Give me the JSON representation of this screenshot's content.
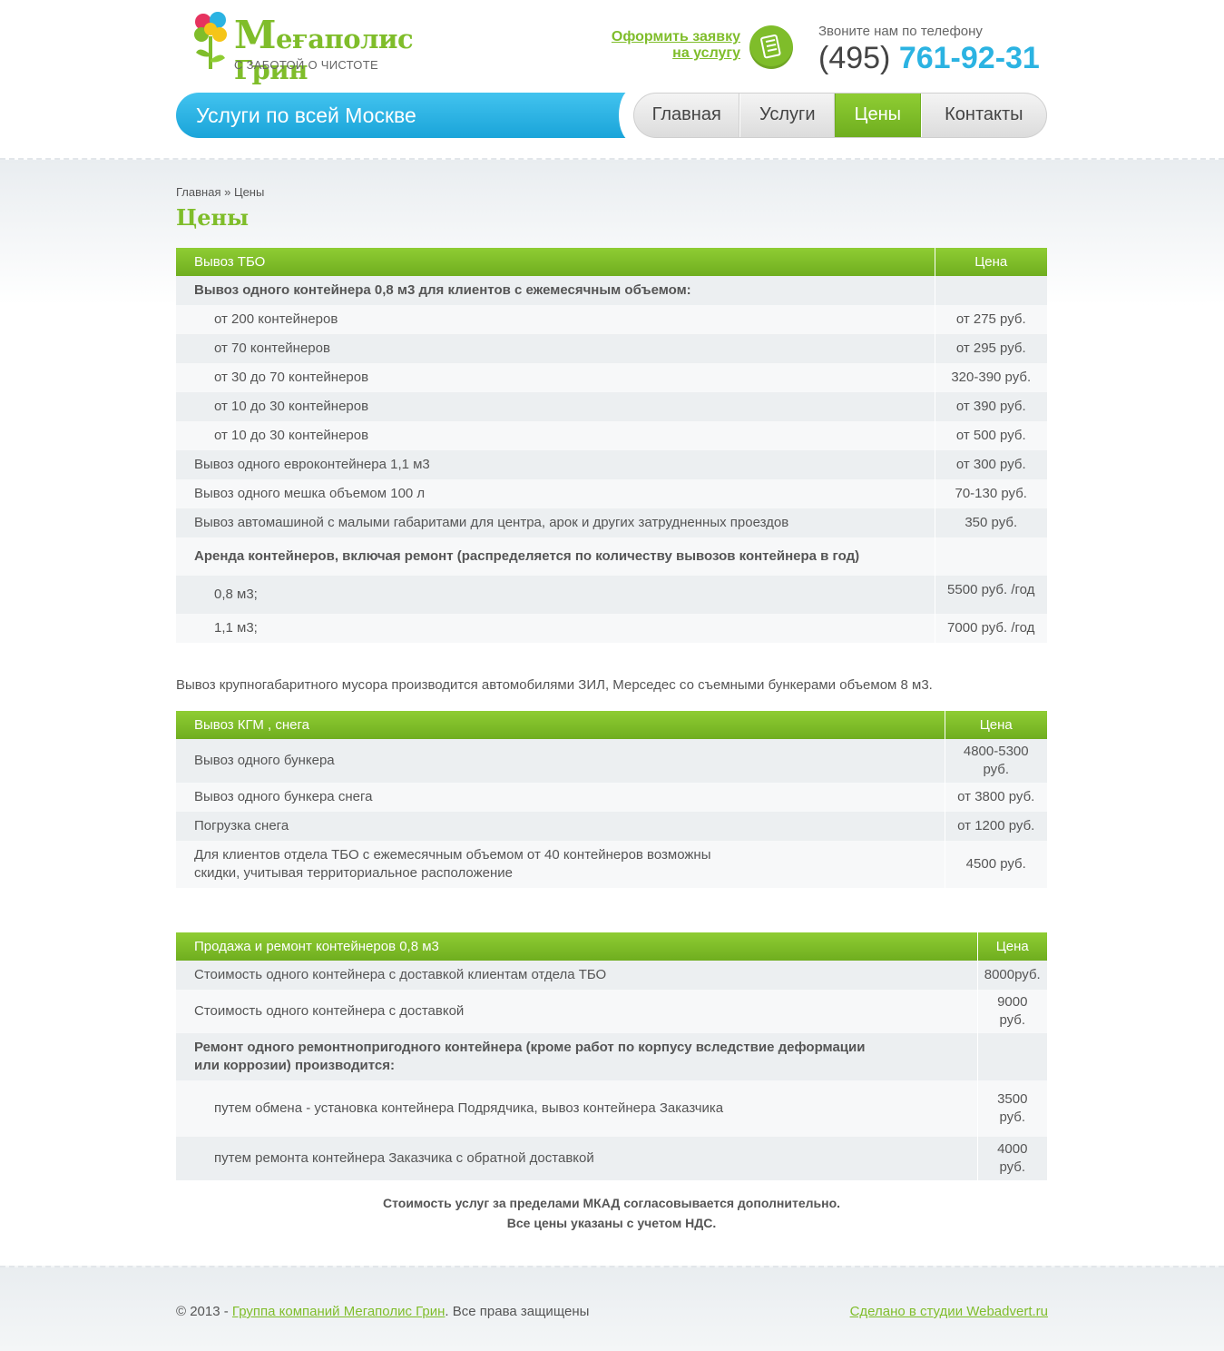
{
  "header": {
    "logo_title_first": "М",
    "logo_title_rest": "еғаполис Грин",
    "logo_subtitle": "С ЗАБОТОЙ О ЧИСТОТЕ",
    "order_line1": "Оформить заявку",
    "order_line2": "на услугу",
    "phone_label": "Звоните нам по телефону",
    "phone_code": "(495)",
    "phone_main": "761-92-31",
    "banner_text": "Услуги по всей Москве"
  },
  "nav": [
    {
      "label": "Главная"
    },
    {
      "label": "Услуги"
    },
    {
      "label": "Цены"
    },
    {
      "label": "Контакты"
    }
  ],
  "breadcrumb": {
    "home": "Главная",
    "sep": " » ",
    "current": "Цены"
  },
  "page_title": "Цены",
  "table1": {
    "head": "Вывоз ТБО",
    "price_head": "Цена",
    "rows": [
      {
        "name": "Вывоз одного контейнера 0,8 м3 для клиентов с ежемесячным объемом:",
        "price": ""
      },
      {
        "name": "от 200 контейнеров",
        "price": "от 275 руб."
      },
      {
        "name": "от 70 контейнеров",
        "price": "от 295 руб."
      },
      {
        "name": "от 30 до 70 контейнеров",
        "price": "320-390 руб."
      },
      {
        "name": "от 10 до 30 контейнеров",
        "price": "от 390 руб."
      },
      {
        "name": "от 10 до 30 контейнеров",
        "price": "от 500 руб."
      },
      {
        "name": "Вывоз одного евроконтейнера 1,1 м3",
        "price": "от 300 руб."
      },
      {
        "name": "Вывоз одного мешка объемом 100 л",
        "price": "70-130 руб."
      },
      {
        "name": "Вывоз автомашиной с малыми габаритами для центра, арок и других затрудненных проездов",
        "price": "350 руб."
      },
      {
        "name": "Аренда контейнеров, включая ремонт (распределяется по количеству вывозов контейнера в год)",
        "price": ""
      },
      {
        "name": "0,8 м3;",
        "price": "5500 руб. /год"
      },
      {
        "name": "1,1 м3;",
        "price": "7000 руб. /год"
      }
    ]
  },
  "note": "Вывоз крупногабаритного мусора производится автомобилями ЗИЛ, Мерседес со съемными бункерами объемом 8 м3.",
  "table2": {
    "head": "Вывоз КГМ , снега",
    "price_head": "Цена",
    "rows": [
      {
        "name": "Вывоз одного бункера",
        "price": "4800-5300 руб."
      },
      {
        "name": "Вывоз одного бункера снега",
        "price": "от 3800 руб."
      },
      {
        "name": "Погрузка снега",
        "price": "от 1200 руб."
      },
      {
        "name": "Для клиентов отдела ТБО с ежемесячным объемом от 40 контейнеров возможны скидки, учитывая территориальное расположение",
        "price": "4500 руб."
      }
    ]
  },
  "table3": {
    "head": "Продажа и ремонт контейнеров 0,8 м3",
    "price_head": "Цена",
    "rows": [
      {
        "name": "Стоимость одного контейнера с доставкой клиентам отдела ТБО",
        "price": "8000руб."
      },
      {
        "name": "Стоимость одного контейнера с доставкой",
        "price": "9000 руб."
      },
      {
        "name": "Ремонт одного ремонтнопригодного контейнера (кроме работ по корпусу вследствие деформации или коррозии) производится:",
        "price": ""
      },
      {
        "name": "путем обмена - установка контейнера Подрядчика, вывоз контейнера Заказчика",
        "price": "3500 руб."
      },
      {
        "name": "путем ремонта контейнера Заказчика с обратной доставкой",
        "price": "4000 руб."
      }
    ]
  },
  "summary": {
    "line1": "Стоимость услуг за пределами МКАД согласовывается дополнительно.",
    "line2": "Все цены указаны с учетом НДС."
  },
  "footer": {
    "copyright": "© 2013 - ",
    "company_link": "Группа компаний Мегаполис Грин",
    "rights": ". Все права защищены",
    "studio_link": "Сделано в студии Webadvert.ru"
  },
  "colors": {
    "brand_green": "#7fbd2a",
    "brand_blue": "#2bb3e2",
    "text": "#555555"
  }
}
